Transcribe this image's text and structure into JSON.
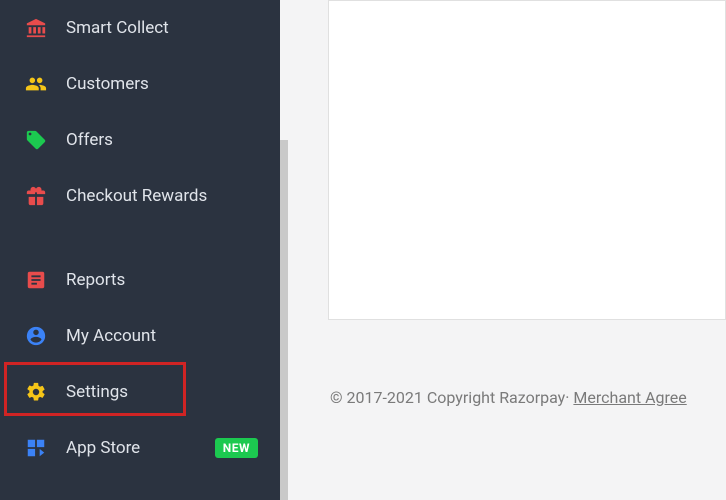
{
  "sidebar": {
    "items": [
      {
        "label": "Smart Collect",
        "icon": "bank-icon",
        "color": "#e84c4c"
      },
      {
        "label": "Customers",
        "icon": "people-icon",
        "color": "#f5c518"
      },
      {
        "label": "Offers",
        "icon": "tag-icon",
        "color": "#1cc950"
      },
      {
        "label": "Checkout Rewards",
        "icon": "gift-icon",
        "color": "#e84c4c"
      },
      {
        "label": "Reports",
        "icon": "report-icon",
        "color": "#e84c4c"
      },
      {
        "label": "My Account",
        "icon": "user-circle-icon",
        "color": "#3b82f6"
      },
      {
        "label": "Settings",
        "icon": "gear-icon",
        "color": "#f5c518"
      },
      {
        "label": "App Store",
        "icon": "apps-icon",
        "color": "#3b82f6",
        "badge": "NEW"
      }
    ]
  },
  "footer": {
    "copyright": "© 2017-2021 Copyright Razorpay· ",
    "link": "Merchant Agree"
  }
}
